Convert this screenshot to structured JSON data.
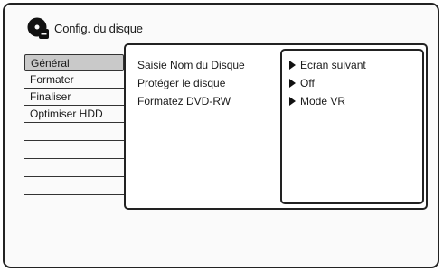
{
  "header": {
    "title": "Config. du disque",
    "icon": "disc-settings-icon"
  },
  "menu": {
    "items": [
      {
        "label": "Général",
        "selected": true
      },
      {
        "label": "Formater",
        "selected": false
      },
      {
        "label": "Finaliser",
        "selected": false
      },
      {
        "label": "Optimiser HDD",
        "selected": false
      }
    ]
  },
  "settings": {
    "labels": [
      "Saisie Nom du Disque",
      "Protéger le disque",
      "Formatez DVD-RW"
    ],
    "values": [
      "Ecran suivant",
      "Off",
      "Mode VR"
    ]
  }
}
